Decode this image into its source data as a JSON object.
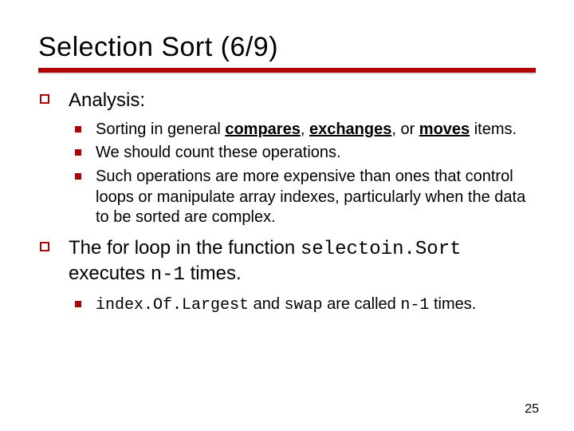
{
  "title": "Selection Sort (6/9)",
  "top": {
    "item1": {
      "label": "Analysis:",
      "sub": {
        "a": {
          "pre": "Sorting in general ",
          "k1": "compares",
          "mid1": ", ",
          "k2": "exchanges",
          "mid2": ", or ",
          "k3": "moves",
          "post": " items."
        },
        "b": "We should count these operations.",
        "c": "Such operations are more expensive than ones that control loops or manipulate array indexes, particularly when the data to be sorted are complex."
      }
    },
    "item2": {
      "p1": "The for loop in the function ",
      "c1": "selectoin.Sort",
      "p2": " executes ",
      "c2": "n-1",
      "p3": " times.",
      "sub": {
        "a": {
          "c1": "index.Of.Largest",
          "t1": " and ",
          "c2": "swap",
          "t2": " are called  ",
          "c3": "n-1",
          "t3": " times."
        }
      }
    }
  },
  "page_number": "25"
}
